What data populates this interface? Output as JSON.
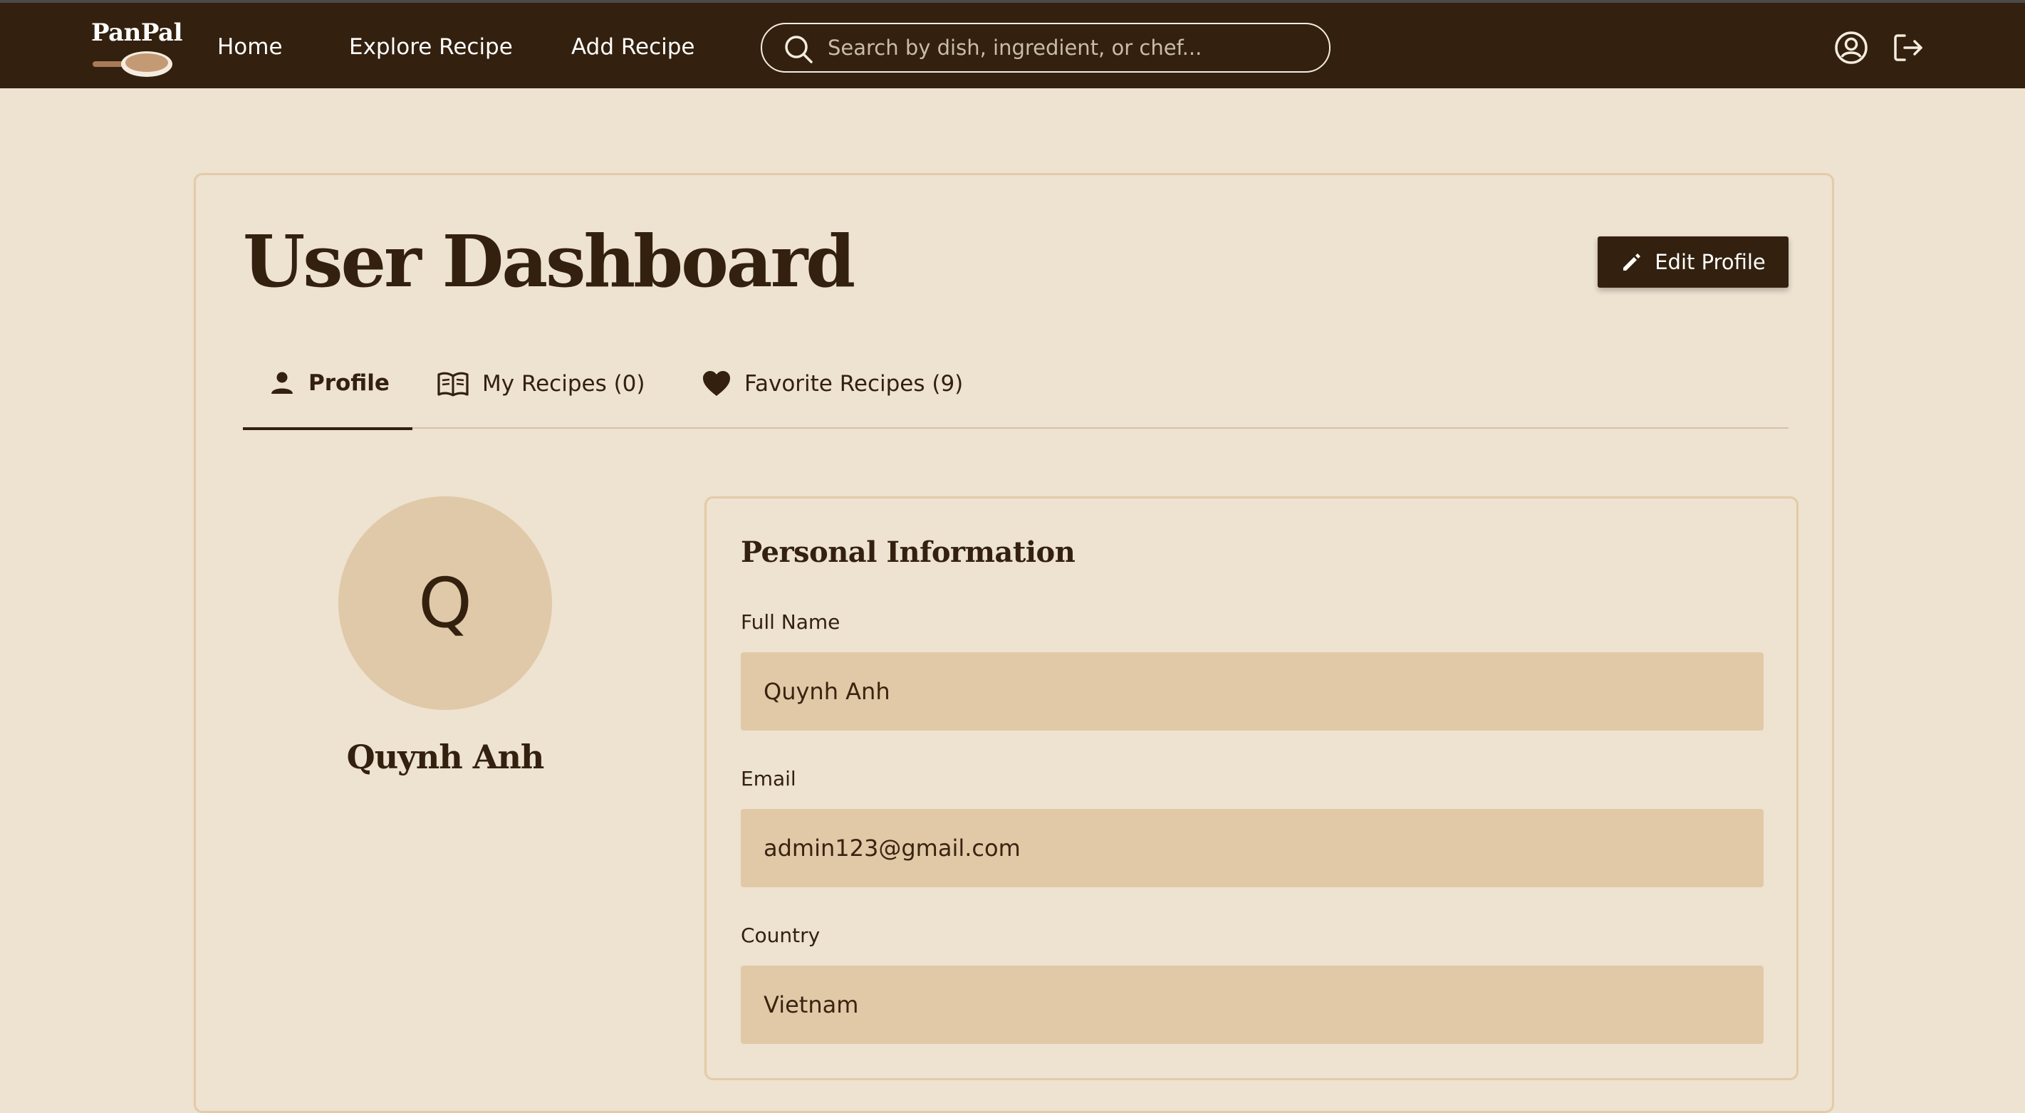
{
  "nav": {
    "logo_text": "PanPal",
    "links": [
      "Home",
      "Explore Recipe",
      "Add Recipe"
    ],
    "search_placeholder": "Search by dish, ingredient, or chef..."
  },
  "dashboard": {
    "title": "User Dashboard",
    "edit_button": "Edit Profile",
    "tabs": [
      {
        "label": "Profile",
        "icon": "person-icon",
        "active": true
      },
      {
        "label": "My Recipes (0)",
        "icon": "book-icon",
        "active": false
      },
      {
        "label": "Favorite Recipes (9)",
        "icon": "heart-icon",
        "active": false
      }
    ]
  },
  "profile": {
    "avatar_initial": "Q",
    "display_name": "Quynh Anh",
    "section_title": "Personal Information",
    "fields": [
      {
        "label": "Full Name",
        "value": "Quynh Anh"
      },
      {
        "label": "Email",
        "value": "admin123@gmail.com"
      },
      {
        "label": "Country",
        "value": "Vietnam"
      }
    ]
  },
  "colors": {
    "nav_bg": "#33200e",
    "page_bg": "#eee2d0",
    "input_bg": "#e1c9a8",
    "border": "#e2cba9",
    "text_dark": "#33200e"
  }
}
